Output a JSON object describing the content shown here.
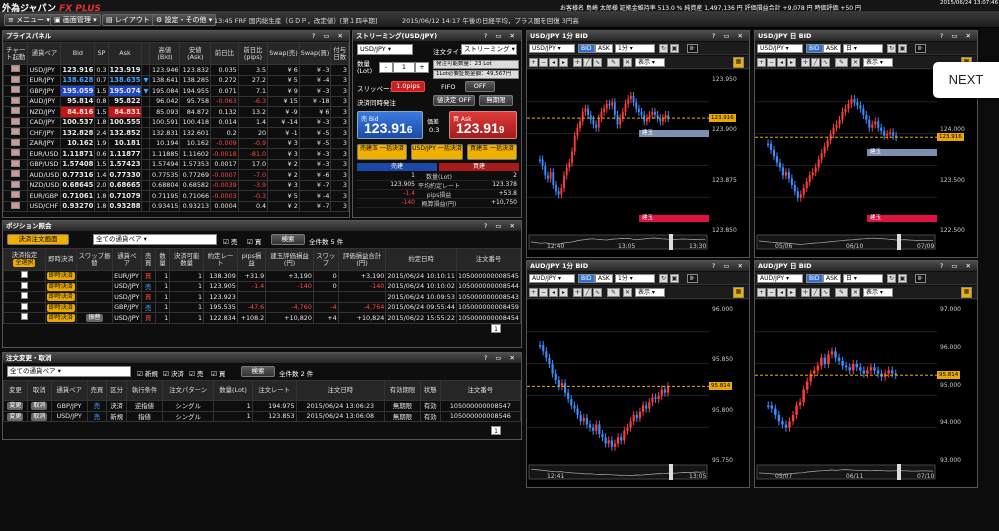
{
  "topbar": {
    "brand": "外為ジャパン",
    "brand_fx": "FX PLUS",
    "account": "お客様名 島崎 太郎様 証拠金維持率 513.0 % 純資産 1,497,136 円 評価損益合計 +9,078 円 時価評価 +50 円",
    "datetime": "2015/06/24 13:07:46"
  },
  "menu": {
    "menu_label": "メニュー",
    "screen_label": "画面管理",
    "layout_label": "レイアウト",
    "settings_label": "設定・その他",
    "ticker1": "13:45 FRF 国内総生産（ＧＤＰ，改定値）[第１四半期]",
    "ticker2": "2015/06/12 14:17 午後の日経平均，プラス圏を回復 3円高"
  },
  "price_panel": {
    "title": "プライスパネル",
    "headers": [
      "チャート起動",
      "通貨ペア",
      "Bid",
      "SP",
      "Ask",
      "",
      "高値(Bid)",
      "安値(Ask)",
      "前日比",
      "前日比(pips)",
      "Swap(売)",
      "Swap(買)",
      "付与日数"
    ],
    "rows": [
      [
        "USD/JPY",
        "123.916",
        "0.3",
        "123.919",
        "",
        "123.946",
        "123.832",
        "0.035",
        "3.5",
        "¥ 6",
        "¥ -3",
        "3"
      ],
      [
        "EUR/JPY",
        "138.628",
        "0.7",
        "138.635",
        "▼",
        "138.641",
        "138.285",
        "0.272",
        "27.2",
        "¥ 5",
        "¥ -4",
        "3"
      ],
      [
        "GBP/JPY",
        "195.059",
        "1.5",
        "195.074",
        "▼",
        "195.084",
        "194.955",
        "0.071",
        "7.1",
        "¥ 9",
        "¥ -3",
        "3"
      ],
      [
        "AUD/JPY",
        "95.814",
        "0.8",
        "95.822",
        "",
        "96.042",
        "95.758",
        "-0.063",
        "-6.3",
        "¥ 15",
        "¥ -18",
        "3"
      ],
      [
        "NZD/JPY",
        "84.816",
        "1.5",
        "84.831",
        "",
        "85.093",
        "84.872",
        "0.132",
        "13.2",
        "¥ -9",
        "¥ 6",
        "3"
      ],
      [
        "CAD/JPY",
        "100.537",
        "1.8",
        "100.555",
        "",
        "100.591",
        "100.418",
        "0.014",
        "1.4",
        "¥ -14",
        "¥ -3",
        "3"
      ],
      [
        "CHF/JPY",
        "132.828",
        "2.4",
        "132.852",
        "",
        "132.831",
        "132.601",
        "0.2",
        "20",
        "¥ -1",
        "¥ -5",
        "3"
      ],
      [
        "ZAR/JPY",
        "10.162",
        "1.9",
        "10.181",
        "",
        "10.194",
        "10.162",
        "-0.009",
        "-0.9",
        "¥ 3",
        "¥ -5",
        "3"
      ],
      [
        "EUR/USD",
        "1.11871",
        "0.6",
        "1.11877",
        "",
        "1.11885",
        "1.11602",
        "-0.0018",
        "-81.0",
        "¥ 3",
        "¥ -3",
        "3"
      ],
      [
        "GBP/USD",
        "1.57408",
        "1.5",
        "1.57423",
        "",
        "1.57494",
        "1.57353",
        "0.0017",
        "17.0",
        "¥ 2",
        "¥ -3",
        "3"
      ],
      [
        "AUD/USD",
        "0.77316",
        "1.4",
        "0.77330",
        "",
        "0.77535",
        "0.77269",
        "-0.0007",
        "-7.0",
        "¥ 2",
        "¥ -6",
        "3"
      ],
      [
        "NZD/USD",
        "0.68645",
        "2.0",
        "0.68665",
        "",
        "0.68804",
        "0.68582",
        "-0.0039",
        "-3.9",
        "¥ 3",
        "¥ -7",
        "3"
      ],
      [
        "EUR/GBP",
        "0.71061",
        "1.8",
        "0.71079",
        "",
        "0.71195",
        "0.71066",
        "-0.0003",
        "-0.3",
        "¥ 5",
        "¥ -4",
        "3"
      ],
      [
        "USD/CHF",
        "0.93270",
        "1.8",
        "0.93288",
        "",
        "0.93415",
        "0.93213",
        "0.0004",
        "0.4",
        "¥ 2",
        "¥ -7",
        "3"
      ]
    ]
  },
  "streaming": {
    "title": "ストリーミング(USD/JPY)",
    "pair": "USD/JPY",
    "order_type_label": "注文タイプ",
    "order_type": "ストリーミング",
    "qty_label": "数量(Lot)",
    "qty": "1",
    "margin_label": "発注可能数量：23 Lot",
    "req_label": "1Lot必要証拠金額：49,567円",
    "slip_label": "スリッページ",
    "slip": "1.0pips",
    "fifo_label": "FIFO",
    "fifo": "OFF",
    "settle_label": "決済同時発注",
    "settle_btn": "値決定 OFF",
    "no_limit_btn": "無期限",
    "bid_label": "売 Bid",
    "bid_big": "123.91",
    "bid_small": "6",
    "spread_label": "価差",
    "spread": "0.3",
    "ask_label": "買 Ask",
    "ask_big": "123.91",
    "ask_small": "9",
    "btn1": "売建玉 一括決済",
    "btn2": "USD/JPY 一括決済",
    "btn3": "買建玉 一括決済",
    "sell_col": "売建",
    "buy_col": "買建",
    "stats": [
      [
        "1",
        "数量(Lot)",
        "2"
      ],
      [
        "123.905",
        "平均約定レート",
        "123.378"
      ],
      [
        "-1.4",
        "pips損益",
        "+53.8"
      ],
      [
        "-140",
        "概算損益(円)",
        "+10,750"
      ]
    ]
  },
  "positions": {
    "title": "ポジション照会",
    "settle_btn": "決済注文画面",
    "filter": "全ての通貨ペア",
    "cb1": "売",
    "cb2": "買",
    "search_btn": "検索",
    "count": "全件数 5 件",
    "headers": [
      "決済指定",
      "即時決済",
      "スワップ振替",
      "通貨ペア",
      "売買",
      "数量",
      "決済可能数量",
      "約定レート",
      "pips損益",
      "建玉評価損益(円)",
      "スワップ",
      "評価損益合計(円)",
      "約定日時",
      "注文番号"
    ],
    "header_btn": "全選択",
    "rows": [
      [
        "即時決済",
        "",
        "EUR/JPY",
        "買",
        "1",
        "1",
        "138.309",
        "+31.9",
        "+3,190",
        "0",
        "+3,190",
        "2015/06/24 10:10:11",
        "105000000008545"
      ],
      [
        "即時決済",
        "",
        "USD/JPY",
        "売",
        "1",
        "1",
        "123.905",
        "-1.4",
        "-140",
        "0",
        "-140",
        "2015/06/24 10:10:02",
        "105000000008544"
      ],
      [
        "即時決済",
        "",
        "USD/JPY",
        "買",
        "1",
        "1",
        "123.923",
        "",
        "",
        "",
        "",
        "2015/06/24 10:09:53",
        "105000000008543"
      ],
      [
        "即時決済",
        "",
        "GBP/JPY",
        "売",
        "1",
        "1",
        "195.535",
        "-47.6",
        "-4,760",
        "-4",
        "-4,764",
        "2015/06/24 09:55:44",
        "105000000008459"
      ],
      [
        "即時決済",
        "振替",
        "USD/JPY",
        "買",
        "1",
        "1",
        "122.834",
        "+108.2",
        "+10,820",
        "+4",
        "+10,824",
        "2015/06/22 15:55:22",
        "105000000008454"
      ]
    ],
    "page": "1"
  },
  "orders": {
    "title": "注文変更・取消",
    "filter": "全ての通貨ペア",
    "cb1": "新規",
    "cb2": "決済",
    "cb3": "売",
    "cb4": "買",
    "search_btn": "検索",
    "count": "全件数 2 件",
    "headers": [
      "変更",
      "取消",
      "通貨ペア",
      "売買",
      "区分",
      "執行条件",
      "注文パターン",
      "数量(Lot)",
      "注文レート",
      "注文日時",
      "有効期限",
      "状態",
      "注文番号"
    ],
    "rows": [
      [
        "変更",
        "取消",
        "GBP/JPY",
        "売",
        "決済",
        "逆指値",
        "シングル",
        "1",
        "194.975",
        "2015/06/24 13:06:23",
        "無期限",
        "有効",
        "105000000008547"
      ],
      [
        "変更",
        "取消",
        "USD/JPY",
        "売",
        "新規",
        "指値",
        "シングル",
        "1",
        "123.853",
        "2015/06/24 13:06:08",
        "無期限",
        "有効",
        "105000000008546"
      ]
    ],
    "page": "1"
  },
  "charts": [
    {
      "title": "USD/JPY 1分 BID",
      "pair": "USD/JPY",
      "tf": "1分",
      "display": "表示",
      "price_tag": "123.916",
      "y_ticks": [
        "123.950",
        "123.900",
        "123.875",
        "123.850"
      ],
      "x_ticks": [
        "12:40",
        "13:05",
        "13:30"
      ],
      "pos_label": "建玉",
      "pos_label2": "建玉"
    },
    {
      "title": "USD/JPY 日 BID",
      "pair": "USD/JPY",
      "tf": "日",
      "display": "表示",
      "price_tag": "123.916",
      "y_ticks": [
        "125.000",
        "124.000",
        "123.500",
        "122.500"
      ],
      "x_ticks": [
        "05/06",
        "06/10",
        "07/09"
      ],
      "pos_label": "建玉",
      "pos_label2": "建玉"
    },
    {
      "title": "AUD/JPY 1分 BID",
      "pair": "AUD/JPY",
      "tf": "1分",
      "display": "表示",
      "price_tag": "95.814",
      "y_ticks": [
        "96.000",
        "95.850",
        "95.800",
        "95.750"
      ],
      "x_ticks": [
        "12:41",
        "13:05"
      ],
      "pos_label": "",
      "pos_label2": ""
    },
    {
      "title": "AUD/JPY 日 BID",
      "pair": "AUD/JPY",
      "tf": "日",
      "display": "表示",
      "price_tag": "95.814",
      "y_ticks": [
        "97.000",
        "96.000",
        "95.000",
        "94.000",
        "93.000"
      ],
      "x_ticks": [
        "05/07",
        "06/11",
        "07/10"
      ],
      "pos_label": "",
      "pos_label2": ""
    }
  ],
  "chart_btns": {
    "bid": "BID",
    "ask": "ASK"
  },
  "next_label": "NEXT",
  "colors": {
    "accent": "#e8a900",
    "bid": "#2f6fd1",
    "ask": "#d22"
  }
}
